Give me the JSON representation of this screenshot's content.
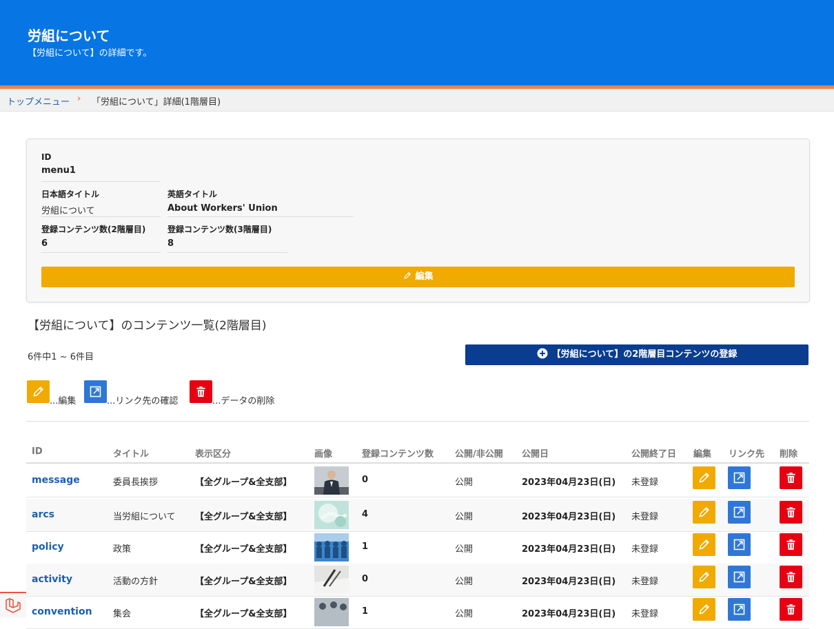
{
  "header": {
    "title": "労組について",
    "subtitle": "【労組について】の詳細です。"
  },
  "breadcrumb": {
    "home": "トップメニュー",
    "separator": "›",
    "current": "「労組について」詳細(1階層目)"
  },
  "detail": {
    "id_label": "ID",
    "id_value": "menu1",
    "ja_title_label": "日本語タイトル",
    "ja_title_value": "労組について",
    "en_title_label": "英語タイトル",
    "en_title_value": "About Workers' Union",
    "count2_label": "登録コンテンツ数(2階層目)",
    "count2_value": "6",
    "count3_label": "登録コンテンツ数(3階層目)",
    "count3_value": "8",
    "edit_button": "編集"
  },
  "section_title": "【労組について】のコンテンツ一覧(2階層目)",
  "count_text": "6件中1 ~ 6件目",
  "register_button": "【労組について】の2階層目コンテンツの登録",
  "legend": {
    "edit": "...編集",
    "link": "...リンク先の確認",
    "delete": "...データの削除"
  },
  "table": {
    "headers": [
      "ID",
      "タイトル",
      "表示区分",
      "画像",
      "登録コンテンツ数",
      "公開/非公開",
      "公開日",
      "公開終了日",
      "編集",
      "リンク先",
      "削除"
    ],
    "rows": [
      {
        "id": "message",
        "title": "委員長挨拶",
        "category": "【全グループ&全支部】",
        "count": "0",
        "status": "公開",
        "pub_date": "2023年04月23日(日)",
        "end_date": "未登録"
      },
      {
        "id": "arcs",
        "title": "当労組について",
        "category": "【全グループ&全支部】",
        "count": "4",
        "status": "公開",
        "pub_date": "2023年04月23日(日)",
        "end_date": "未登録"
      },
      {
        "id": "policy",
        "title": "政策",
        "category": "【全グループ&全支部】",
        "count": "1",
        "status": "公開",
        "pub_date": "2023年04月23日(日)",
        "end_date": "未登録"
      },
      {
        "id": "activity",
        "title": "活動の方針",
        "category": "【全グループ&全支部】",
        "count": "0",
        "status": "公開",
        "pub_date": "2023年04月23日(日)",
        "end_date": "未登録"
      },
      {
        "id": "convention",
        "title": "集会",
        "category": "【全グループ&全支部】",
        "count": "1",
        "status": "公開",
        "pub_date": "2023年04月23日(日)",
        "end_date": "未登録"
      }
    ]
  },
  "colors": {
    "header_blue": "#0775e4",
    "accent_orange": "#f0834a",
    "edit_yellow": "#f0aa00",
    "link_blue": "#2f77d7",
    "delete_red": "#e60012",
    "register_navy": "#0a3d8f"
  }
}
